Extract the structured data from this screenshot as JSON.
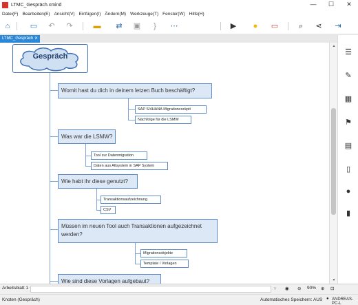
{
  "window": {
    "app_icon": "XMind",
    "title": "LTMC_Gespräch.xmind",
    "minimize": "—",
    "maximize": "☐",
    "close": "✕"
  },
  "menu": [
    "Datei(F)",
    "Bearbeiten(E)",
    "Ansicht(V)",
    "Einfügen(I)",
    "Ändern(M)",
    "Werkzeuge(T)",
    "Fenster(W)",
    "Hilfe(H)"
  ],
  "tab": {
    "label": "LTMC_Gespräch",
    "close": "✕"
  },
  "map": {
    "root": "Gespräch",
    "topics": [
      {
        "label": "Womit hast du dich in deinem letzen Buch  beschäftigt?",
        "subtopics": [
          "SAP S/4HANA Migrationcockpit",
          "Nachfolge für die LSMW"
        ]
      },
      {
        "label": "Was war die LSMW?",
        "subtopics": [
          "Tool zur Datenmigration",
          "Daten aus Altsystem in SAP System"
        ]
      },
      {
        "label": "Wie habt ihr diese genutzt?",
        "subtopics": [
          "Transaktionsaufzeichnung",
          "CSV"
        ]
      },
      {
        "label": "Müssen im neuen Tool auch Transaktionen aufgezeichnet werden?",
        "subtopics": [
          "Migrationsobjekte",
          "Template / Vorlagen"
        ]
      },
      {
        "label": "Wie sind diese Vorlagen aufgebaut?",
        "subtopics": []
      }
    ]
  },
  "sheetbar": {
    "sheet": "Arbeitsblatt 1",
    "zoom": "90%"
  },
  "status": {
    "left": "Knoten (Gespräch)",
    "autosave": "Automatisches Speichern: AUS",
    "user": "ANDREAS-PC-L"
  },
  "colors": {
    "accent": "#2b88d8",
    "topic_fill": "#dce8f6",
    "topic_border": "#5e8bc5"
  }
}
